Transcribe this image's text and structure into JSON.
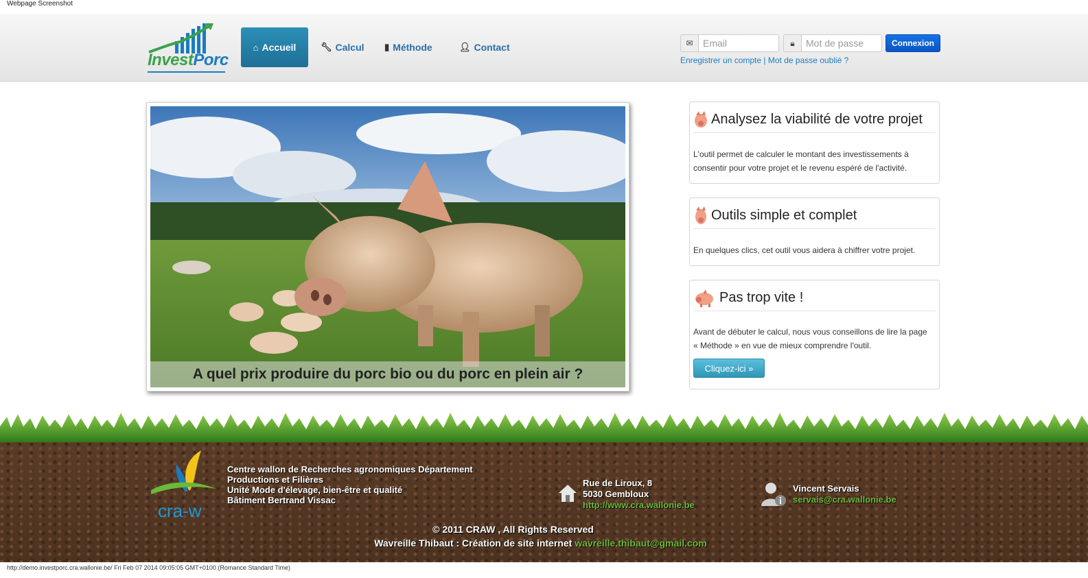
{
  "screenshot_label": "Webpage Screenshot",
  "nav": {
    "brand_part1": "Invest",
    "brand_part2": "Porc",
    "items": [
      {
        "label": "Accueil",
        "icon": "home-icon"
      },
      {
        "label": "Calcul",
        "icon": "wrench-icon"
      },
      {
        "label": "Méthode",
        "icon": "book-icon"
      },
      {
        "label": "Contact",
        "icon": "user-icon"
      }
    ]
  },
  "login": {
    "email_placeholder": "Email",
    "password_placeholder": "Mot de passe",
    "submit_label": "Connexion",
    "register_link": "Enregistrer un compte",
    "separator": "|",
    "forgot_link": "Mot de passe oublié ?"
  },
  "hero": {
    "caption": "A quel prix produire du porc bio ou du porc en plein air ?"
  },
  "boxes": [
    {
      "title": "Analysez la viabilité de votre projet",
      "text": "L'outil permet de calculer le montant des investissements à consentir pour votre projet et le revenu espéré de l'activité."
    },
    {
      "title": "Outils simple et complet",
      "text": "En quelques clics, cet outil vous aidera à chiffrer votre projet."
    },
    {
      "title": "Pas trop vite !",
      "text": "Avant de débuter le calcul, nous vous conseillons de lire la page « Méthode » en vue de mieux comprendre l'outil.",
      "button": "Cliquez-ici »"
    }
  ],
  "footer": {
    "craw_logo_text": "cra-w",
    "org_lines": [
      "Centre wallon de Recherches agronomiques Département",
      "Productions et Filières",
      "Unité Mode d'élevage, bien-être et qualité",
      "Bâtiment Bertrand Vissac"
    ],
    "address_line1": "Rue de Liroux, 8",
    "address_line2": "5030 Gembloux",
    "website": "http://www.cra.wallonie.be",
    "contact_name": "Vincent Servais",
    "contact_email": "servais@cra.wallonie.be",
    "copyright": "© 2011 CRAW , All Rights Reserved",
    "credit_text": "Wavreille Thibaut : Création de site internet",
    "credit_email": "wavreille.thibaut@gmail.com"
  },
  "status_bar": "http://demo.investporc.cra.wallonie.be/ Fri Feb 07 2014 09:05:05 GMT+0100 (Romance Standard Time)",
  "colors": {
    "accent": "#2c8fb8",
    "link": "#1a7cc1",
    "green": "#6ab93b",
    "connexion": "#1473e6"
  }
}
